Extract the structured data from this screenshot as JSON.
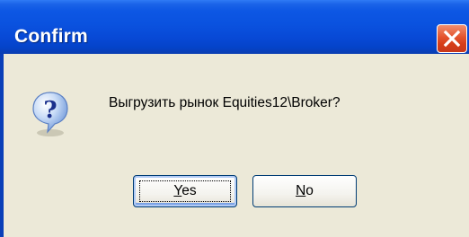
{
  "dialog": {
    "title": "Confirm",
    "message": "Выгрузить рынок Equities12\\Broker?",
    "buttons": {
      "yes": {
        "mnemonic": "Y",
        "rest": "es",
        "label": "Yes"
      },
      "no": {
        "mnemonic": "N",
        "rest": "o",
        "label": "No"
      }
    },
    "icons": {
      "dialog_icon": "question-icon",
      "close": "close-icon"
    },
    "colors": {
      "titlebar": "#0a52df",
      "close_button": "#e4532d",
      "body": "#ece9d8",
      "button_border": "#003c74"
    }
  }
}
